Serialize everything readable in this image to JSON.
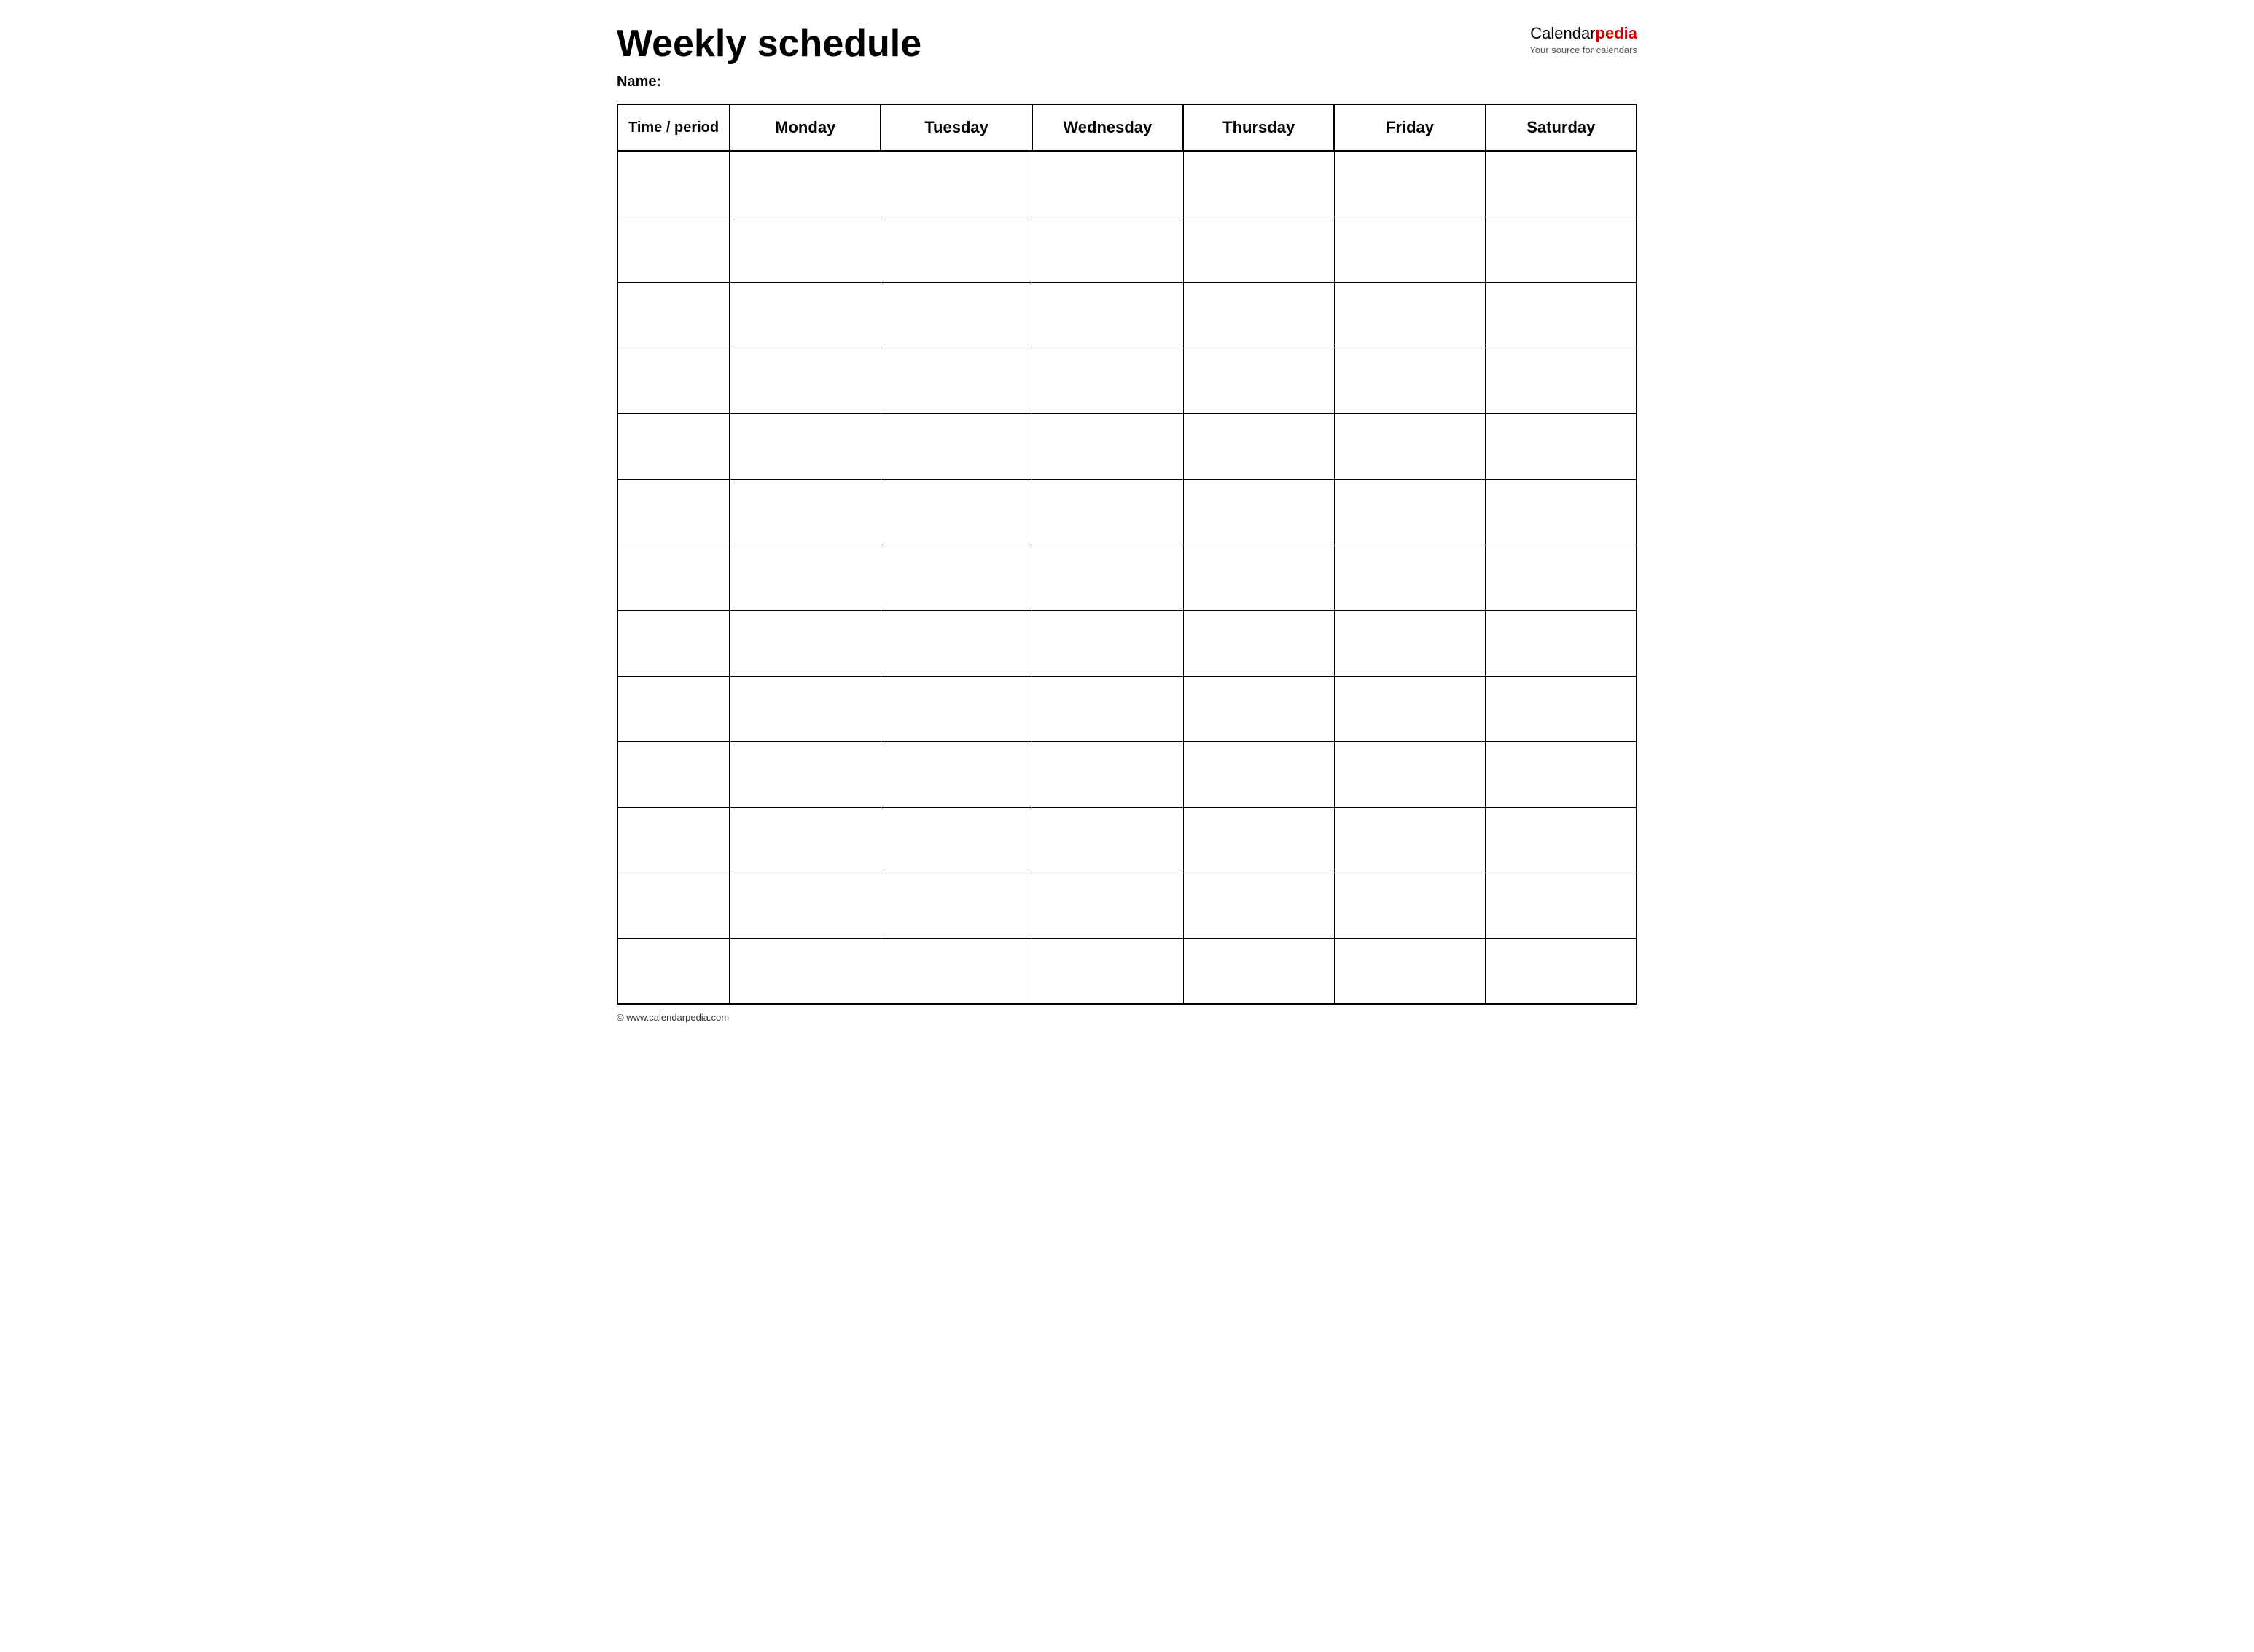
{
  "header": {
    "title": "Weekly schedule",
    "name_label": "Name:",
    "brand_name_part1": "Calendar",
    "brand_name_part2": "pedia",
    "brand_tagline": "Your source for calendars"
  },
  "table": {
    "columns": [
      {
        "label": "Time / period",
        "type": "time"
      },
      {
        "label": "Monday",
        "type": "day"
      },
      {
        "label": "Tuesday",
        "type": "day"
      },
      {
        "label": "Wednesday",
        "type": "day"
      },
      {
        "label": "Thursday",
        "type": "day"
      },
      {
        "label": "Friday",
        "type": "day"
      },
      {
        "label": "Saturday",
        "type": "day"
      }
    ],
    "row_count": 13
  },
  "footer": {
    "text": "© www.calendarpedia.com"
  }
}
